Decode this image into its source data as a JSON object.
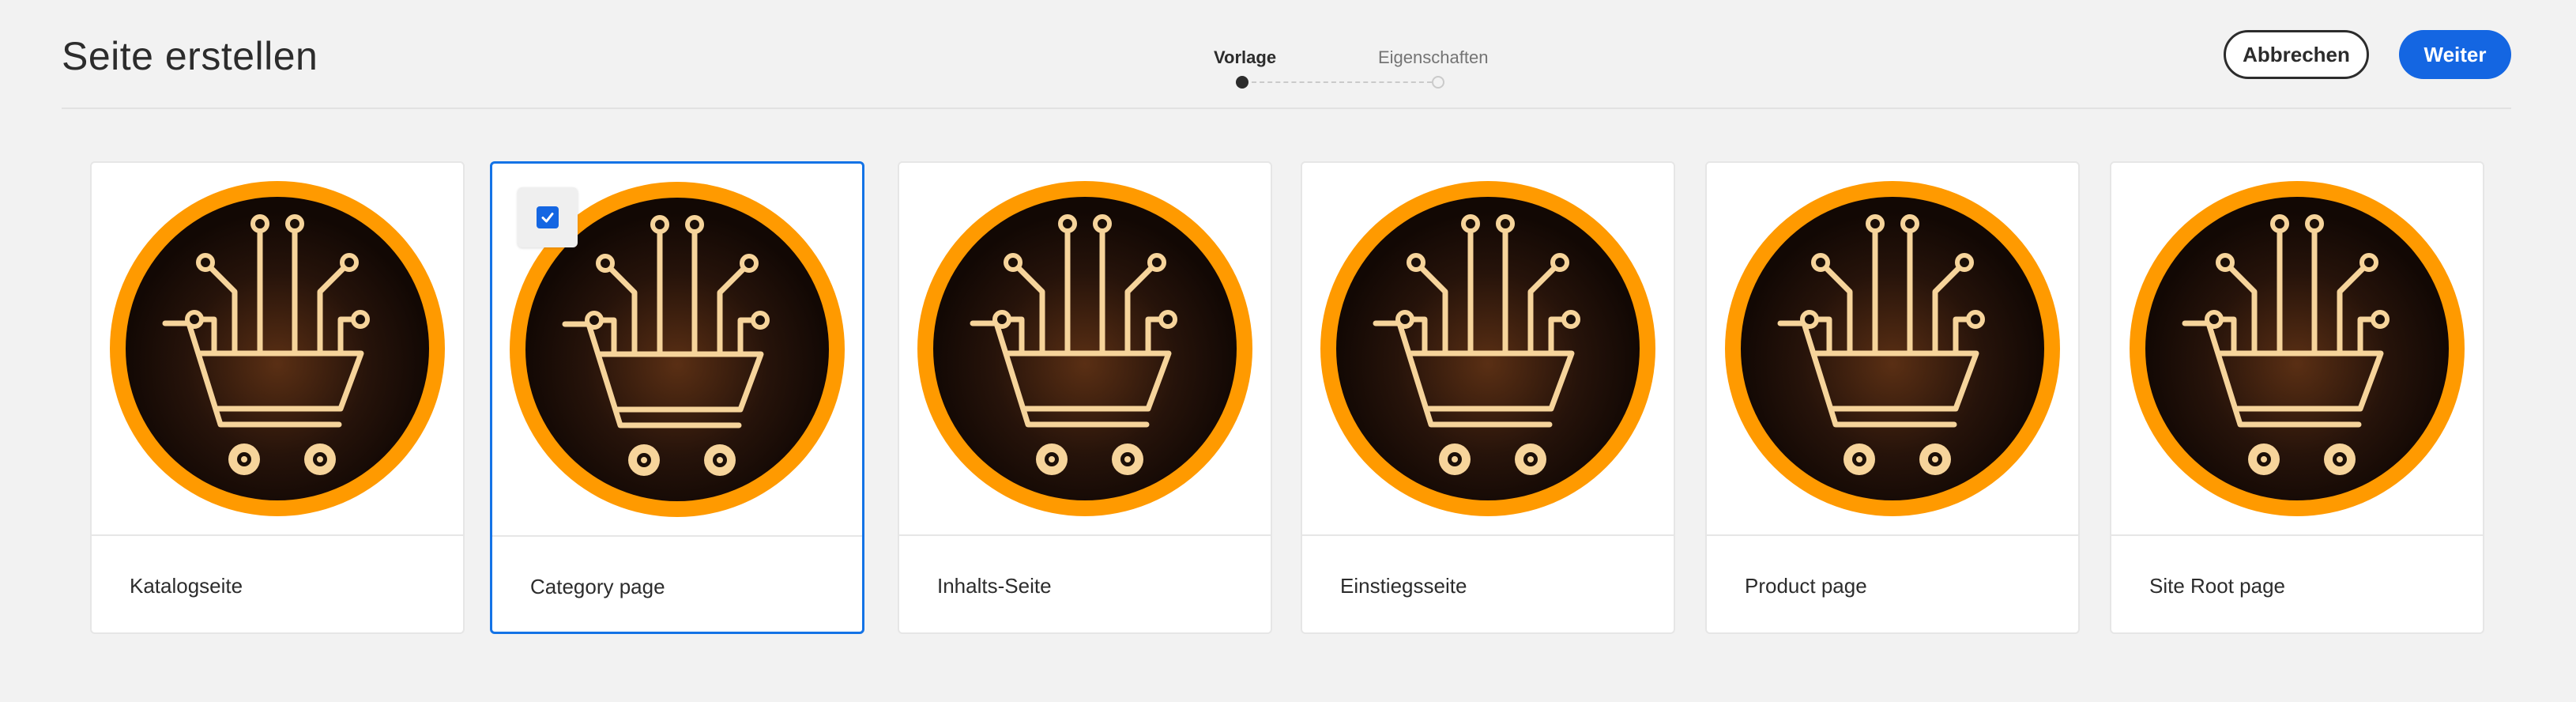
{
  "header": {
    "title": "Seite erstellen",
    "cancel_label": "Abbrechen",
    "next_label": "Weiter"
  },
  "stepper": {
    "steps": [
      {
        "label": "Vorlage",
        "state": "active"
      },
      {
        "label": "Eigenschaften",
        "state": "inactive"
      }
    ]
  },
  "templates": [
    {
      "label": "Katalogseite",
      "selected": false
    },
    {
      "label": "Category page",
      "selected": true
    },
    {
      "label": "Inhalts-Seite",
      "selected": false
    },
    {
      "label": "Einstiegsseite",
      "selected": false
    },
    {
      "label": "Product page",
      "selected": false
    },
    {
      "label": "Site Root page",
      "selected": false
    }
  ],
  "colors": {
    "accent_blue": "#1466e2",
    "thumbnail_ring": "#ff9a00",
    "thumbnail_bg": "#1b0f08",
    "thumbnail_line": "#f6d49b"
  },
  "icons": {
    "thumbnail": "shopping-cart-circuit-icon",
    "checkbox": "checkmark-icon"
  }
}
